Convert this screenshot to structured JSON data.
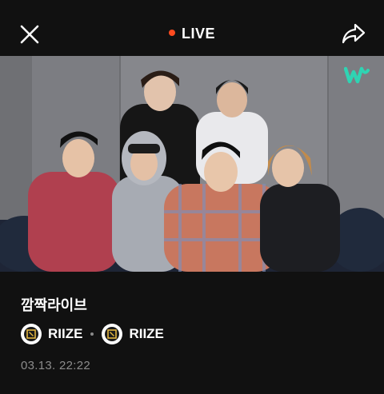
{
  "header": {
    "live_label": "LIVE",
    "live_dot_color": "#ff4b1f",
    "close_icon": "close-icon",
    "share_icon": "share-icon"
  },
  "video": {
    "watermark_icon": "weverse-logo-icon",
    "watermark_color": "#2fd4b3"
  },
  "info": {
    "title": "깜짝라이브",
    "channels": [
      {
        "name": "RIIZE"
      },
      {
        "name": "RIIZE"
      }
    ],
    "date": "03.13. 22:22"
  }
}
